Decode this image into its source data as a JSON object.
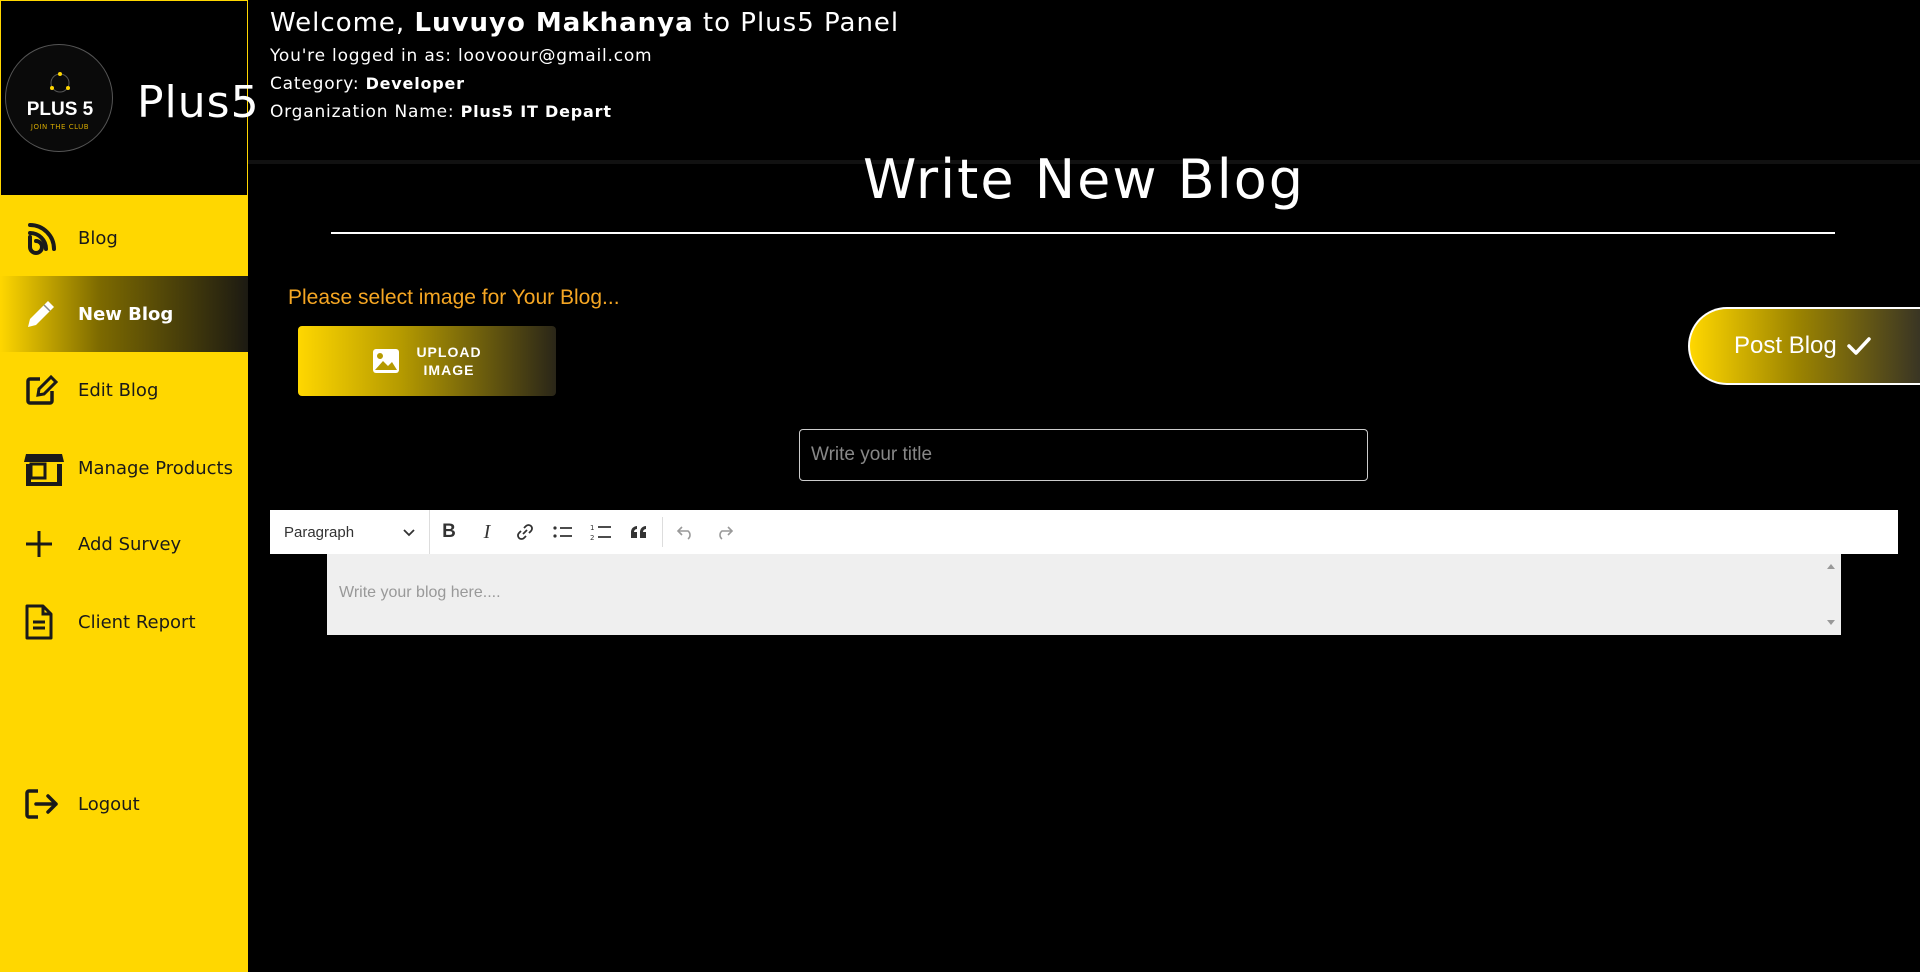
{
  "brand": {
    "logo_text": "PLUS 5",
    "logo_sub": "JOIN THE CLUB",
    "name": "Plus5"
  },
  "header": {
    "welcome_prefix": "Welcome,",
    "user_name": "Luvuyo Makhanya",
    "welcome_suffix": "to Plus5 Panel",
    "logged_label": "You're logged in as:",
    "email": "loovoour@gmail.com",
    "category_label": "Category:",
    "category": "Developer",
    "org_label": "Organization Name:",
    "org": "Plus5 IT Depart"
  },
  "sidebar": {
    "items": [
      {
        "label": "Blog",
        "icon": "blog-rss-icon"
      },
      {
        "label": "New Blog",
        "icon": "pencil-icon",
        "active": true
      },
      {
        "label": "Edit Blog",
        "icon": "edit-icon"
      },
      {
        "label": "Manage Products",
        "icon": "store-icon"
      },
      {
        "label": "Add Survey",
        "icon": "plus-icon"
      },
      {
        "label": "Client Report",
        "icon": "file-icon"
      }
    ],
    "logout": {
      "label": "Logout",
      "icon": "logout-icon"
    }
  },
  "main": {
    "page_title": "Write New Blog",
    "select_hint": "Please select image for Your Blog...",
    "upload_line1": "UPLOAD",
    "upload_line2": "IMAGE",
    "post_label": "Post Blog",
    "title_placeholder": "Write your title",
    "editor": {
      "format_value": "Paragraph",
      "placeholder": "Write your blog here...."
    }
  },
  "colors": {
    "accent": "#FFD700",
    "hint": "#F5A623",
    "background": "#000000"
  }
}
